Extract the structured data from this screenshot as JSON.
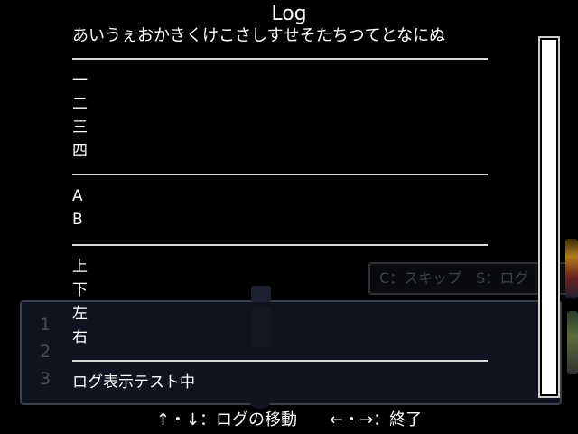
{
  "scene": {
    "message_window_lines": [
      "1",
      "2",
      "3"
    ],
    "skip_hint": "C：スキップ　S：ログ"
  },
  "log": {
    "title": "Log",
    "entries": [
      {
        "lines": [
          "あいうぇおかきくけこさしすせそたちつてとなにぬ"
        ]
      },
      {
        "lines": [
          "一",
          "二",
          "三",
          "四"
        ]
      },
      {
        "lines": [
          "A",
          "B"
        ]
      },
      {
        "lines": [
          "上",
          "下",
          "左",
          "右"
        ]
      },
      {
        "lines": [
          "ログ表示テスト中"
        ]
      }
    ],
    "scroll_position": 1.0
  },
  "footer": {
    "hint": "↑・↓：ログの移動　　←・→：終了"
  }
}
